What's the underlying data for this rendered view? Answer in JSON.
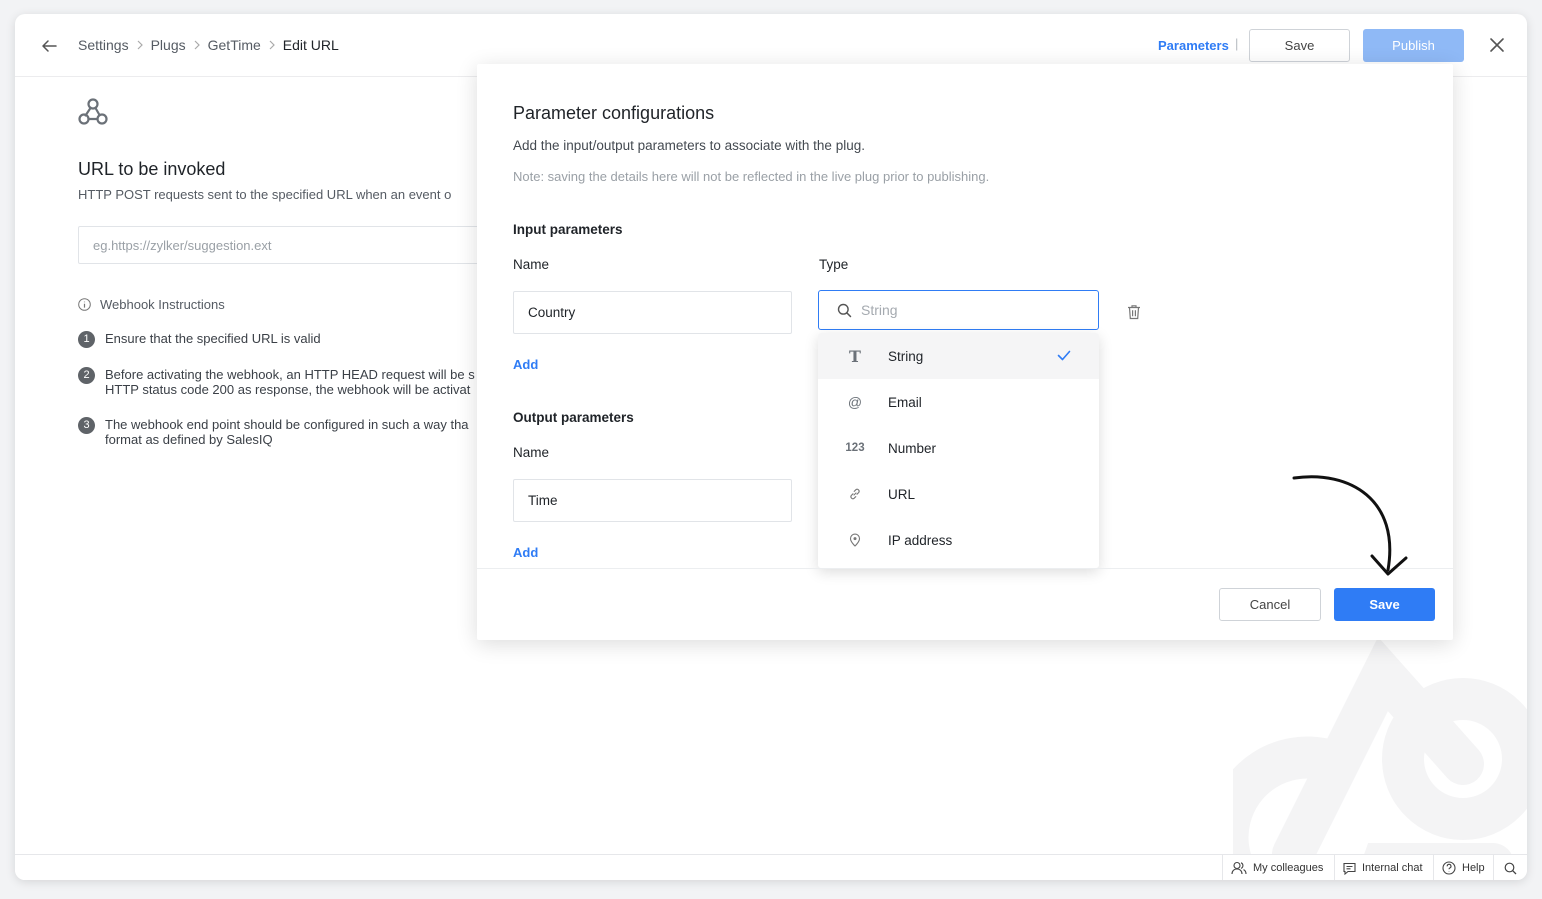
{
  "header": {
    "breadcrumb": [
      "Settings",
      "Plugs",
      "GetTime",
      "Edit URL"
    ],
    "parameters_link": "Parameters",
    "separator": "|",
    "save_label": "Save",
    "publish_label": "Publish"
  },
  "page": {
    "url_title": "URL to be invoked",
    "url_desc": "HTTP POST requests sent to the specified URL when an event o",
    "url_placeholder": "eg.https://zylker/suggestion.ext",
    "instructions_title": "Webhook Instructions",
    "instructions": [
      {
        "num": "1",
        "line1": "Ensure that the specified URL is valid",
        "line2": ""
      },
      {
        "num": "2",
        "line1": "Before activating the webhook, an HTTP HEAD request will be s",
        "line2": "HTTP status code 200 as response, the webhook will be activat"
      },
      {
        "num": "3",
        "line1": "The webhook end point should be configured in such a way tha",
        "line2": "format as defined by SalesIQ"
      }
    ]
  },
  "modal": {
    "title": "Parameter configurations",
    "subtitle": "Add the input/output parameters to associate with the plug.",
    "note": "Note: saving the details here will not be reflected in the live plug prior to publishing.",
    "input_section": "Input parameters",
    "output_section": "Output parameters",
    "name_label": "Name",
    "type_label": "Type",
    "input_name_value": "Country",
    "output_name_value": "Time",
    "add_label": "Add",
    "type_search_placeholder": "String",
    "type_options": [
      {
        "icon": "T",
        "label": "String",
        "selected": true
      },
      {
        "icon": "@",
        "label": "Email",
        "selected": false
      },
      {
        "icon": "123",
        "label": "Number",
        "selected": false
      },
      {
        "icon": "link-icon",
        "label": "URL",
        "selected": false
      },
      {
        "icon": "location-pin-icon",
        "label": "IP address",
        "selected": false
      }
    ],
    "cancel_label": "Cancel",
    "save_label": "Save"
  },
  "footer": {
    "colleagues": "My colleagues",
    "internal_chat": "Internal chat",
    "help": "Help"
  },
  "colors": {
    "accent": "#2f7cf5",
    "publish_disabled": "#8fb9f6"
  }
}
